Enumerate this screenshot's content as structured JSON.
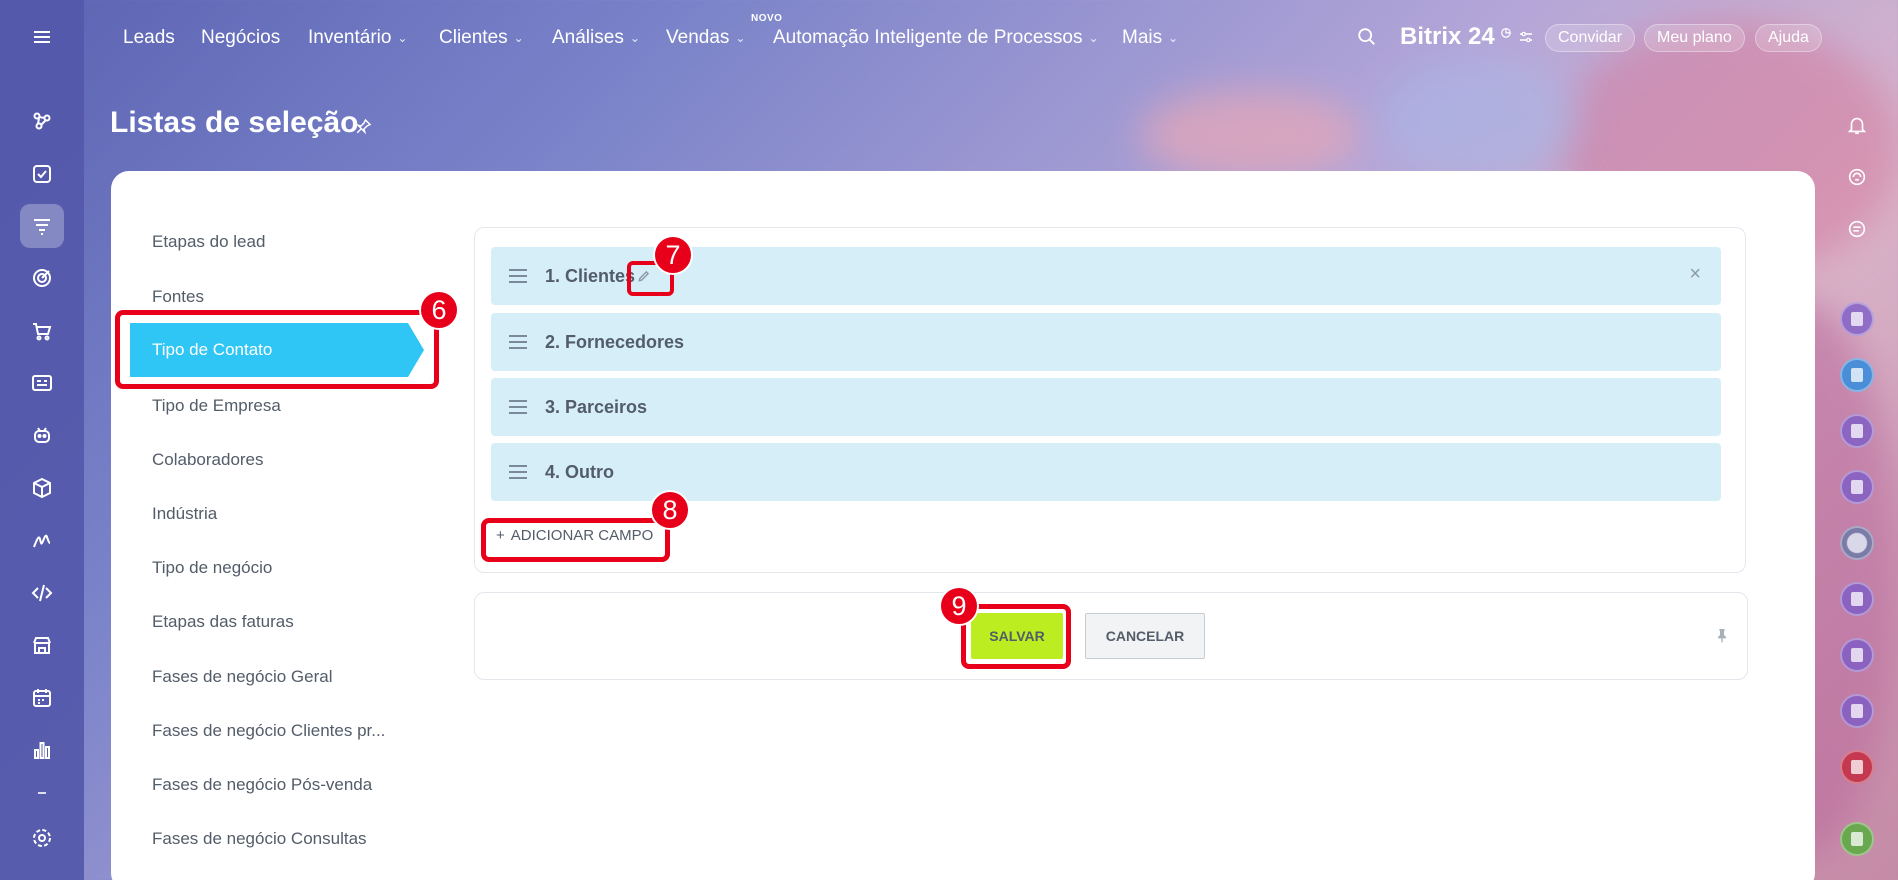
{
  "colors": {
    "rail": "#5458aa",
    "active_item": "#2fc6f6",
    "row_bg": "#d6eef8",
    "save_button": "#bbed21",
    "callout": "#e8001a"
  },
  "left_rail": {
    "icons": [
      "menu-icon",
      "feed-icon",
      "tasks-icon",
      "crm-icon",
      "target-icon",
      "cart-icon",
      "contact-center-icon",
      "robot-icon",
      "inventory-icon",
      "sign-icon",
      "developer-icon",
      "store-icon",
      "calendar-icon",
      "analytics-icon",
      "settings-icon"
    ]
  },
  "top_nav": {
    "items": [
      {
        "label": "Leads",
        "dropdown": false
      },
      {
        "label": "Negócios",
        "dropdown": false
      },
      {
        "label": "Inventário",
        "dropdown": true
      },
      {
        "label": "Clientes",
        "dropdown": true
      },
      {
        "label": "Análises",
        "dropdown": true
      },
      {
        "label": "Vendas",
        "dropdown": true
      },
      {
        "label": "Automação Inteligente de Processos",
        "dropdown": true
      },
      {
        "label": "Mais",
        "dropdown": true
      }
    ],
    "novo_badge": "NOVO",
    "brand": "Bitrix 24",
    "invite": "Convidar",
    "my_plan": "Meu plano",
    "help": "Ajuda"
  },
  "page": {
    "title": "Listas de seleção"
  },
  "sidebar": {
    "items": [
      "Etapas do lead",
      "Fontes",
      "Tipo de Contato",
      "Tipo de Empresa",
      "Colaboradores",
      "Indústria",
      "Tipo de negócio",
      "Etapas das faturas",
      "Fases de negócio Geral",
      "Fases de negócio Clientes pr...",
      "Fases de negócio Pós-venda",
      "Fases de negócio Consultas"
    ],
    "active": "Tipo de Contato"
  },
  "list": {
    "rows": [
      "1. Clientes",
      "2. Fornecedores",
      "3. Parceiros",
      "4. Outro"
    ],
    "add_field": "ADICIONAR CAMPO",
    "add_plus": "+"
  },
  "actions": {
    "save": "SALVAR",
    "cancel": "CANCELAR"
  },
  "callouts": [
    "6",
    "7",
    "8",
    "9"
  ]
}
